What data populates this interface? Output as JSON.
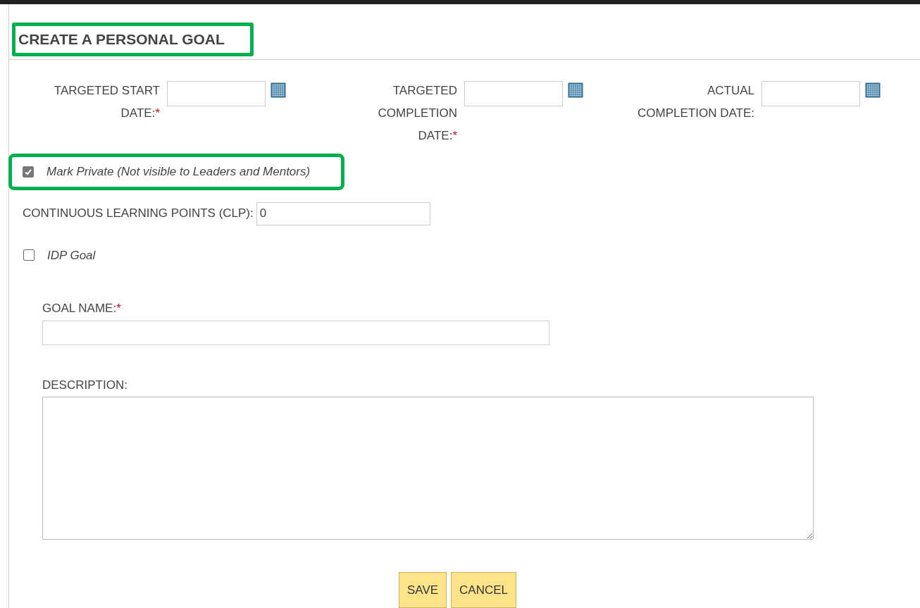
{
  "title": {
    "text": "CREATE A PERSONAL GOAL",
    "highlighted": true
  },
  "date_fields": [
    {
      "label": "TARGETED START DATE:",
      "required": true
    },
    {
      "label": "TARGETED COMPLETION DATE:",
      "required": true
    },
    {
      "label": "ACTUAL COMPLETION DATE:",
      "required": false
    }
  ],
  "required_mark": "*",
  "mark_private": {
    "label": "Mark Private (Not visible to Leaders and Mentors)",
    "checked": true,
    "highlighted": true
  },
  "clp": {
    "label": "CONTINUOUS LEARNING POINTS (CLP):",
    "value": "0"
  },
  "idp_goal": {
    "label": "IDP Goal",
    "checked": false
  },
  "goal_name": {
    "label": "GOAL NAME:",
    "required": true
  },
  "description": {
    "label": "DESCRIPTION:"
  },
  "buttons": [
    "SAVE",
    "CANCEL"
  ]
}
